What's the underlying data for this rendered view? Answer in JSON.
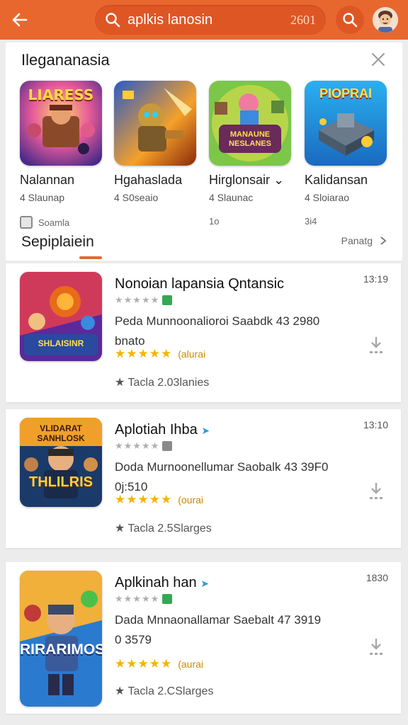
{
  "topbar": {
    "search_query": "aplkis lanosin",
    "search_count": "2601",
    "accent": "#e8672f"
  },
  "featured": {
    "title": "Ilegananasia",
    "items": [
      {
        "name": "Nalannan",
        "sub": "4 Slaunap",
        "meta": "Soamla"
      },
      {
        "name": "Hgahaslada",
        "sub": "4 S0seaio",
        "meta": ""
      },
      {
        "name": "Hirglonsair ⌄",
        "sub": "4 Slaunac",
        "meta": "1o"
      },
      {
        "name": "Kalidansan",
        "sub": "4 Sloiarao",
        "meta": "3i4"
      }
    ],
    "icon_texts": [
      "LIARESS",
      "",
      "MANAUNE NESLANES",
      "PIOPRAI"
    ]
  },
  "section": {
    "title": "Sepiplaiein",
    "more": "Panatg"
  },
  "list": [
    {
      "title": "Nonoian lapansia Qntansic",
      "time": "13:19",
      "desc1": "Peda Munnoonalioroi Saabdk 43 2980",
      "desc2": "bnato",
      "rating_label": "(alurai",
      "foot": "Tacla 2.03lanies",
      "thumb_text": "SHLAISINR"
    },
    {
      "title": "Aplotiah Ihba",
      "time": "13:10",
      "desc1": "Doda Murnoonellumar Saobalk 43 39F0",
      "desc2": "0j:510",
      "rating_label": "(ourai",
      "foot": "Tacla 2.5Slarges",
      "thumb_text": "VLIDARAT SANHLOSK",
      "thumb_big": "THLILRIS"
    },
    {
      "title": "Aplkinah han",
      "time": "1830",
      "desc1": "Dada Mnnaonallamar Saebalt 47 3919",
      "desc2": "0 3579",
      "rating_label": "(aurai",
      "foot": "Tacla 2.CSlarges",
      "thumb_big": "RIRARIMOS"
    }
  ]
}
